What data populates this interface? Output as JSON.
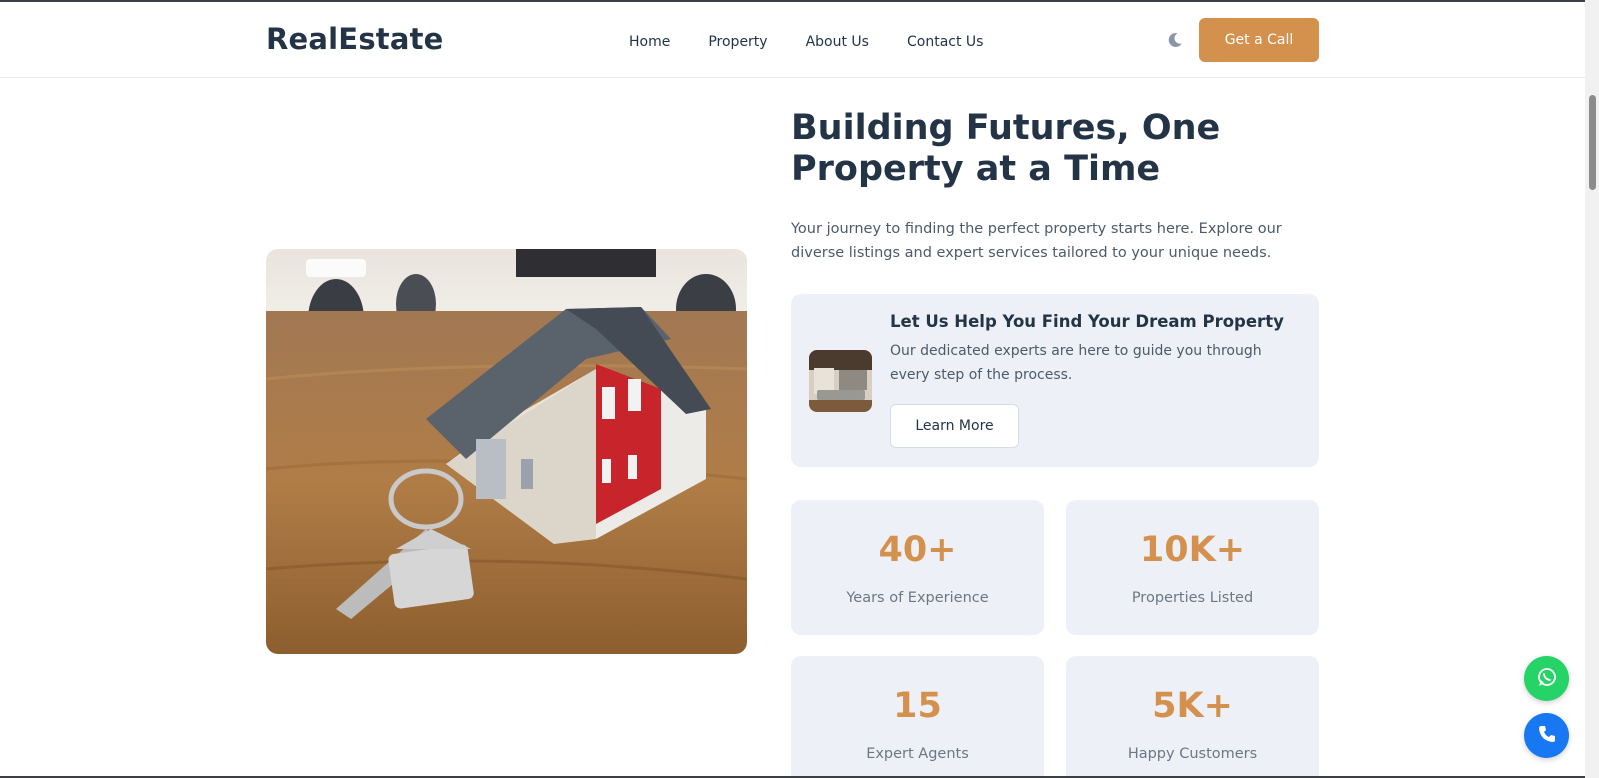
{
  "header": {
    "logo": "RealEstate",
    "nav": [
      "Home",
      "Property",
      "About Us",
      "Contact Us"
    ],
    "theme_toggle_icon": "moon-icon",
    "cta_label": "Get a Call"
  },
  "hero": {
    "title_line1": "Building Futures, One",
    "title_line2": "Property at a Time",
    "subtitle": "Your journey to finding the perfect property starts here. Explore our diverse listings and expert services tailored to your unique needs.",
    "image": "house-model-with-keys-photo"
  },
  "help_card": {
    "title": "Let Us Help You Find Your Dream Property",
    "text": "Our dedicated experts are here to guide you through every step of the process.",
    "button": "Learn More",
    "thumbnail": "living-room-photo"
  },
  "stats": [
    {
      "value": "40+",
      "label": "Years of Experience"
    },
    {
      "value": "10K+",
      "label": "Properties Listed"
    },
    {
      "value": "15",
      "label": "Expert Agents"
    },
    {
      "value": "5K+",
      "label": "Happy Customers"
    }
  ],
  "floating": {
    "whatsapp_icon": "whatsapp-icon",
    "phone_icon": "phone-icon"
  },
  "colors": {
    "accent": "#d4914e",
    "heading": "#243447",
    "card_bg": "#edf1f7",
    "whatsapp": "#25d366",
    "phone": "#1877f2"
  }
}
